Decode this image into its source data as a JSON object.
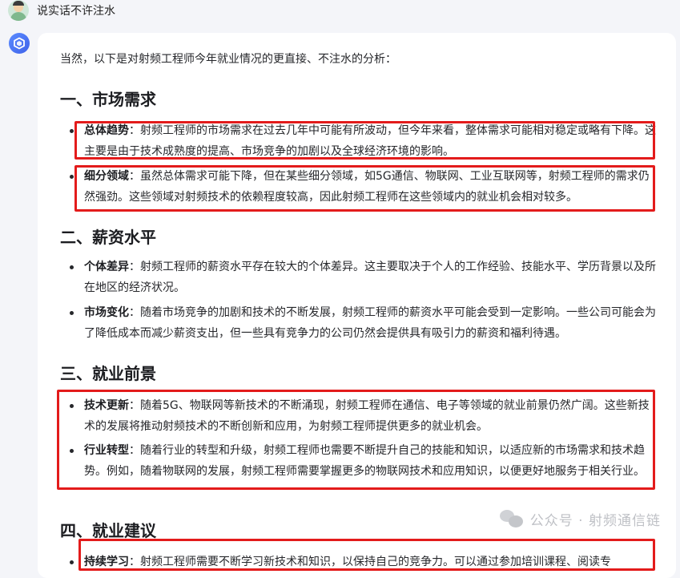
{
  "user": {
    "message": "说实话不许注水"
  },
  "answer": {
    "intro": "当然，以下是对射频工程师今年就业情况的更直接、不注水的分析：",
    "sections": [
      {
        "heading": "一、市场需求",
        "items": [
          {
            "term": "总体趋势",
            "text": "：射频工程师的市场需求在过去几年中可能有所波动，但今年来看，整体需求可能相对稳定或略有下降。这主要是由于技术成熟度的提高、市场竞争的加剧以及全球经济环境的影响。"
          },
          {
            "term": "细分领域",
            "text": "：虽然总体需求可能下降，但在某些细分领域，如5G通信、物联网、工业互联网等，射频工程师的需求仍然强劲。这些领域对射频技术的依赖程度较高，因此射频工程师在这些领域内的就业机会相对较多。"
          }
        ]
      },
      {
        "heading": "二、薪资水平",
        "items": [
          {
            "term": "个体差异",
            "text": "：射频工程师的薪资水平存在较大的个体差异。这主要取决于个人的工作经验、技能水平、学历背景以及所在地区的经济状况。"
          },
          {
            "term": "市场变化",
            "text": "：随着市场竞争的加剧和技术的不断发展，射频工程师的薪资水平可能会受到一定影响。一些公司可能会为了降低成本而减少薪资支出，但一些具有竞争力的公司仍然会提供具有吸引力的薪资和福利待遇。"
          }
        ]
      },
      {
        "heading": "三、就业前景",
        "items": [
          {
            "term": "技术更新",
            "text": "：随着5G、物联网等新技术的不断涌现，射频工程师在通信、电子等领域的就业前景仍然广阔。这些新技术的发展将推动射频技术的不断创新和应用，为射频工程师提供更多的就业机会。"
          },
          {
            "term": "行业转型",
            "text": "：随着行业的转型和升级，射频工程师也需要不断提升自己的技能和知识，以适应新的市场需求和技术趋势。例如，随着物联网的发展，射频工程师需要掌握更多的物联网技术和应用知识，以便更好地服务于相关行业。"
          }
        ]
      },
      {
        "heading": "四、就业建议",
        "items": [
          {
            "term": "持续学习",
            "text": "：射频工程师需要不断学习新技术和知识，以保持自己的竞争力。可以通过参加培训课程、阅读专"
          }
        ]
      }
    ]
  },
  "watermark": {
    "text": "公众号 · 射频通信链"
  },
  "colors": {
    "highlight": "#e31b1b",
    "bot_avatar": "#4a72f0"
  },
  "icons": {
    "bot": "cube-logo-icon",
    "user": "user-avatar",
    "watermark": "wechat-icon"
  }
}
